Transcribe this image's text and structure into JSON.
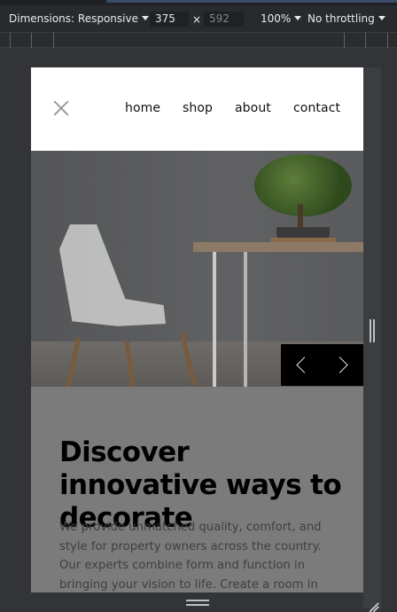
{
  "devtools": {
    "dimensions_label": "Dimensions: Responsive",
    "width_value": "375",
    "height_value": "592",
    "times_symbol": "×",
    "zoom_label": "100%",
    "throttling_label": "No throttling"
  },
  "site": {
    "nav": {
      "links": [
        "home",
        "shop",
        "about",
        "contact"
      ]
    },
    "hero": {
      "headline": "Discover innovative ways to decorate",
      "paragraph": "We provide unmatched quality, comfort, and style for property owners across the country. Our experts combine form and function in bringing your vision to life. Create a room in your own style with our"
    }
  },
  "icons": {
    "close": "close-icon",
    "prev": "chevron-left-icon",
    "next": "chevron-right-icon"
  }
}
